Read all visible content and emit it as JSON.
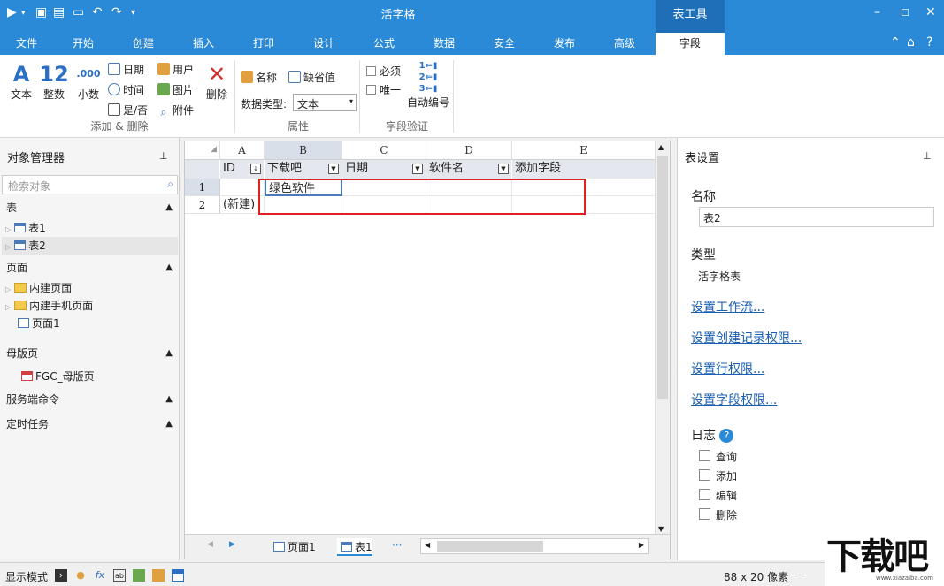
{
  "app_title": "活字格",
  "context_tab": "表工具",
  "tabs": [
    "文件",
    "开始",
    "创建",
    "插入",
    "打印",
    "设计",
    "公式",
    "数据",
    "安全",
    "发布",
    "高级",
    "字段"
  ],
  "ribbon": {
    "text": "文本",
    "int_glyph": "12",
    "int": "整数",
    "dec_glyph": ".000",
    "dec": "小数",
    "date": "日期",
    "time": "时间",
    "yesno": "是/否",
    "user": "用户",
    "image": "图片",
    "attach": "附件",
    "delete": "删除",
    "group_add": "添加 & 删除",
    "name": "名称",
    "default": "缺省值",
    "dtype_label": "数据类型:",
    "dtype_value": "文本",
    "group_prop": "属性",
    "required": "必须",
    "unique": "唯一",
    "autonum": "自动编号",
    "group_valid": "字段验证"
  },
  "left": {
    "header": "对象管理器",
    "search_placeholder": "检索对象",
    "sec_table": "表",
    "table1": "表1",
    "table2": "表2",
    "sec_page": "页面",
    "page_builtin": "内建页面",
    "page_mobile": "内建手机页面",
    "page1": "页面1",
    "sec_master": "母版页",
    "master1": "FGC_母版页",
    "sec_server": "服务端命令",
    "sec_timer": "定时任务"
  },
  "grid": {
    "columns": [
      "A",
      "B",
      "C",
      "D",
      "E"
    ],
    "fields": [
      "ID",
      "下载吧",
      "日期",
      "软件名",
      "添加字段"
    ],
    "rows": [
      "1",
      "2"
    ],
    "cell_b1": "绿色软件",
    "cell_a2": "(新建)",
    "sheet_page": "页面1",
    "sheet_table": "表1",
    "more": "···"
  },
  "right": {
    "header": "表设置",
    "name_label": "名称",
    "name_value": "表2",
    "type_label": "类型",
    "type_value": "活字格表",
    "link_workflow": "设置工作流...",
    "link_create": "设置创建记录权限...",
    "link_row": "设置行权限...",
    "link_field": "设置字段权限...",
    "log_label": "日志",
    "log_query": "查询",
    "log_add": "添加",
    "log_edit": "编辑",
    "log_delete": "删除"
  },
  "status": {
    "mode": "显示模式",
    "size": "88 x 20 像素"
  },
  "watermark": {
    "brand": "下载吧",
    "url": "www.xiazaiba.com"
  },
  "colors": {
    "accent": "#2b8ad8",
    "highlight": "#e02020"
  }
}
